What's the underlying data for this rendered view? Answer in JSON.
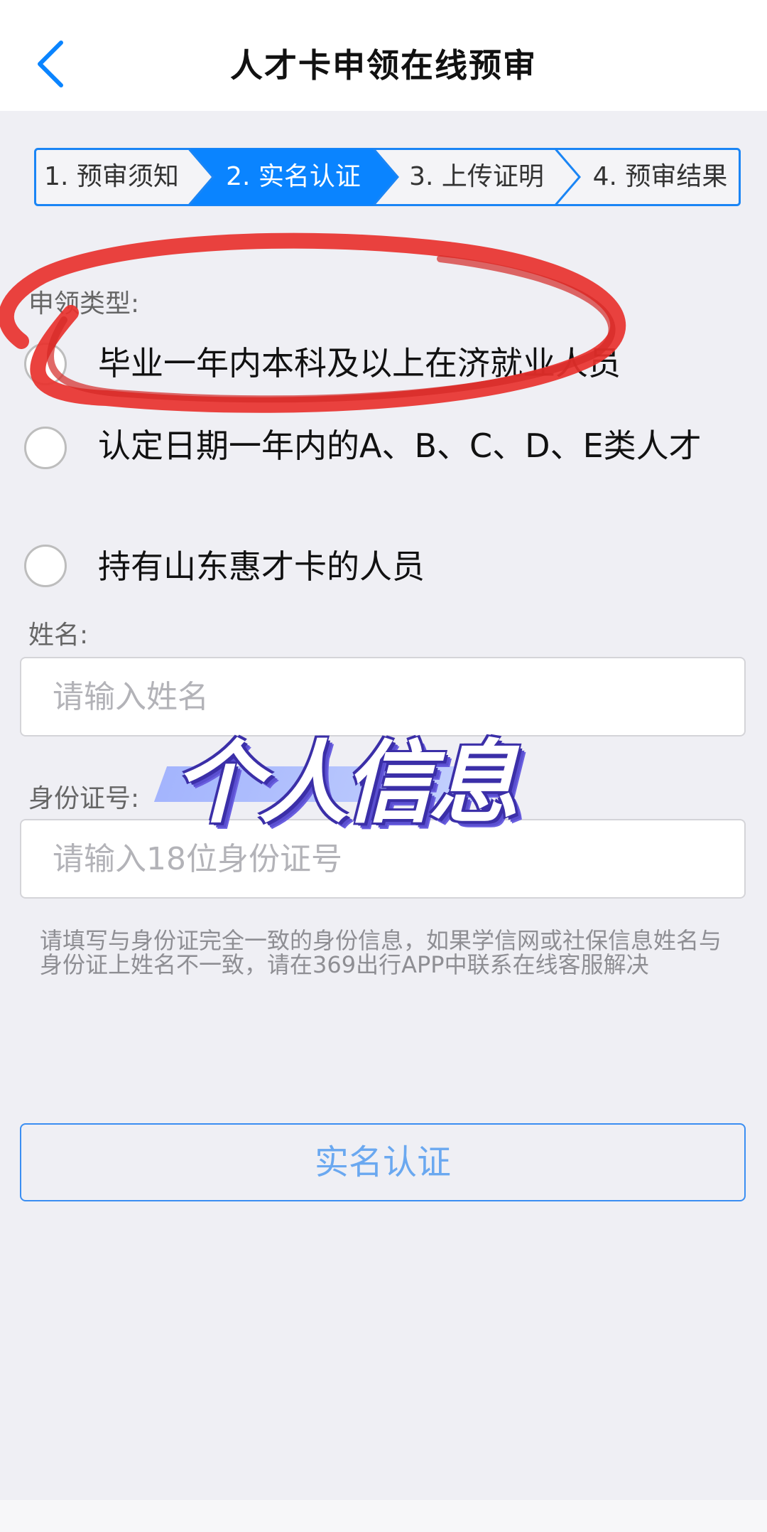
{
  "header": {
    "title": "人才卡申领在线预审",
    "back_icon": "chevron-left-icon"
  },
  "steps": [
    {
      "label": "1. 预审须知",
      "active": false
    },
    {
      "label": "2. 实名认证",
      "active": true
    },
    {
      "label": "3. 上传证明",
      "active": false
    },
    {
      "label": "4. 预审结果",
      "active": false
    }
  ],
  "form": {
    "type_label": "申领类型:",
    "options": [
      {
        "label": "毕业一年内本科及以上在济就业人员",
        "selected": false
      },
      {
        "label": "认定日期一年内的A、B、C、D、E类人才",
        "selected": false
      },
      {
        "label": "持有山东惠才卡的人员",
        "selected": false
      }
    ],
    "name_label": "姓名:",
    "name_placeholder": "请输入姓名",
    "name_value": "",
    "id_label": "身份证号:",
    "id_placeholder": "请输入18位身份证号",
    "id_value": "",
    "notice": "请填写与身份证完全一致的身份信息，如果学信网或社保信息姓名与身份证上姓名不一致，请在369出行APP中联系在线客服解决",
    "submit_label": "实名认证"
  },
  "overlay": {
    "caption": "个人信息"
  },
  "colors": {
    "accent": "#0a84ff",
    "border": "#3a8ef2",
    "background": "#efeff4",
    "annotation": "#e8322e"
  }
}
